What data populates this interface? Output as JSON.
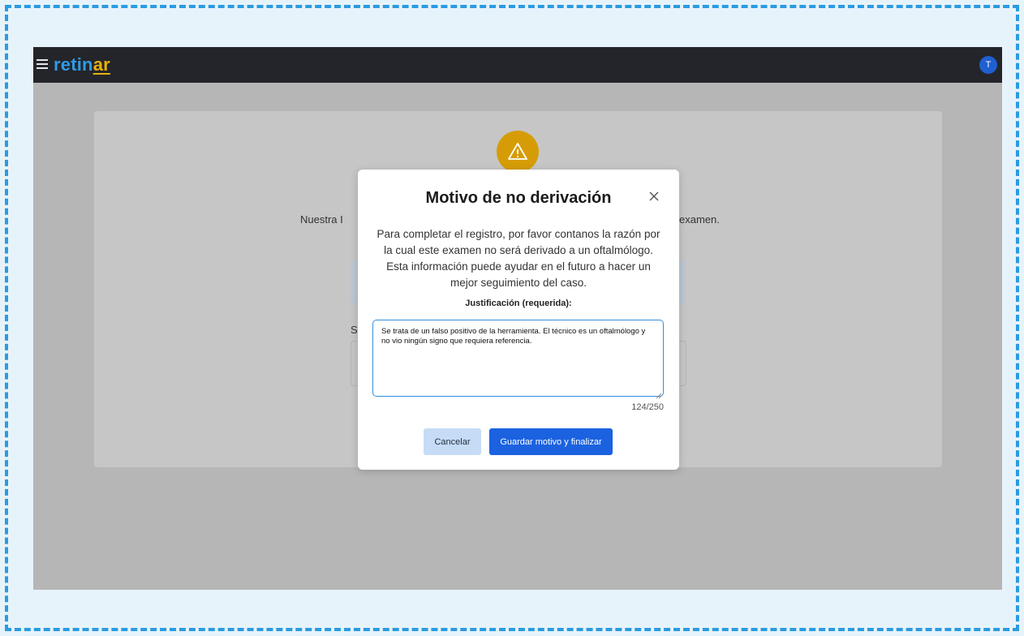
{
  "app": {
    "logo_part1": "retin",
    "logo_part2": "ar",
    "avatar_initial": "T"
  },
  "background": {
    "text_left": "Nuestra I",
    "text_right": "examen.",
    "label_s": "S"
  },
  "modal": {
    "title": "Motivo de no derivación",
    "description": "Para completar el registro, por favor contanos la razón por la cual este examen no será derivado a un oftalmólogo. Esta información puede ayudar en el futuro a hacer un mejor seguimiento del caso.",
    "field_label": "Justificación (requerida):",
    "justification_value": "Se trata de un falso positivo de la herramienta. El técnico es un oftalmólogo y no vio ningún signo que requiera referencia.",
    "char_count": "124/250",
    "cancel_label": "Cancelar",
    "save_label": "Guardar motivo y finalizar"
  },
  "colors": {
    "accent_blue": "#1b62e0",
    "logo_blue": "#2f9be6",
    "logo_yellow": "#e7b20a",
    "warning": "#d69c07",
    "topbar": "#24252b"
  },
  "icons": [
    "menu-icon",
    "warning-icon",
    "close-icon",
    "resize-handle-icon"
  ]
}
